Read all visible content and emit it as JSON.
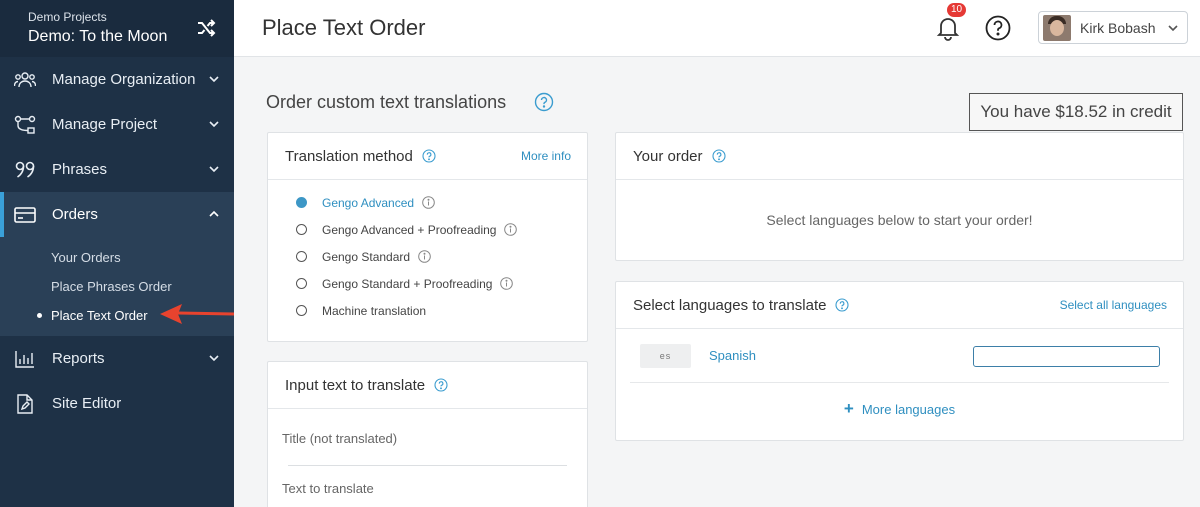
{
  "sidebar": {
    "project_label": "Demo Projects",
    "project_name": "Demo: To the Moon",
    "nav": [
      {
        "label": "Manage Organization",
        "icon": "people-icon"
      },
      {
        "label": "Manage Project",
        "icon": "workflow-icon"
      },
      {
        "label": "Phrases",
        "icon": "quote-icon"
      },
      {
        "label": "Orders",
        "icon": "card-icon"
      },
      {
        "label": "Reports",
        "icon": "bar-chart-icon"
      },
      {
        "label": "Site Editor",
        "icon": "document-edit-icon"
      }
    ],
    "orders_sub": [
      {
        "label": "Your Orders"
      },
      {
        "label": "Place Phrases Order"
      },
      {
        "label": "Place Text Order"
      }
    ]
  },
  "header": {
    "title": "Place Text Order",
    "notification_count": "10",
    "user_name": "Kirk Bobash"
  },
  "main": {
    "title": "Order custom text translations",
    "credit": "You have $18.52 in credit",
    "translation_method": {
      "title": "Translation method",
      "link": "More info",
      "options": [
        {
          "label": "Gengo Advanced",
          "selected": true
        },
        {
          "label": "Gengo Advanced + Proofreading",
          "selected": false
        },
        {
          "label": "Gengo Standard",
          "selected": false
        },
        {
          "label": "Gengo Standard + Proofreading",
          "selected": false
        },
        {
          "label": "Machine translation",
          "selected": false
        }
      ]
    },
    "your_order": {
      "title": "Your order",
      "empty_text": "Select languages below to start your order!"
    },
    "select_languages": {
      "title": "Select languages to translate",
      "link": "Select all languages",
      "languages": [
        {
          "code": "es",
          "name": "Spanish"
        }
      ],
      "more": "More languages"
    },
    "input_text": {
      "title": "Input text to translate",
      "title_field": "Title  (not translated)",
      "text_field": "Text to translate"
    }
  },
  "colors": {
    "sidebar_bg": "#1e3146",
    "accent": "#3aa0d8",
    "link": "#2f8fc0",
    "badge": "#e53935"
  }
}
